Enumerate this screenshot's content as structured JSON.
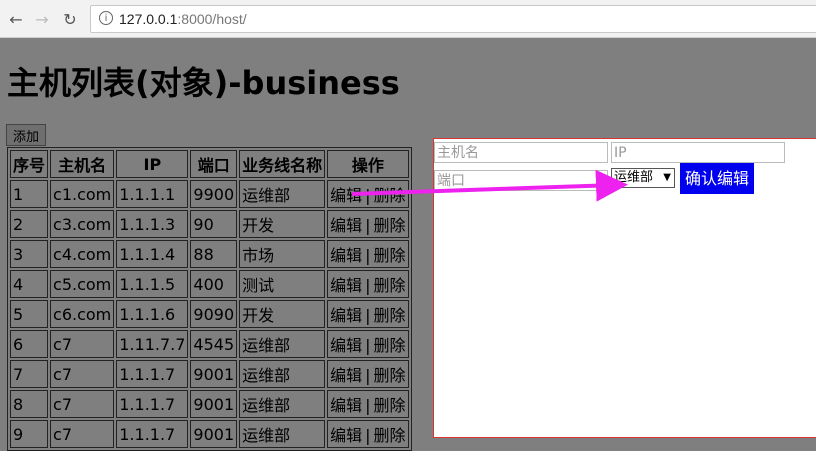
{
  "browser": {
    "url_host": "127.0.0.1",
    "url_path": ":8000/host/",
    "back_icon": "arrow-left-icon",
    "forward_icon": "arrow-right-icon",
    "reload_icon": "reload-icon",
    "info_icon": "info-icon"
  },
  "page": {
    "title": "主机列表(对象)-business",
    "add_label": "添加"
  },
  "table": {
    "headers": [
      "序号",
      "主机名",
      "IP",
      "端口",
      "业务线名称",
      "操作"
    ],
    "rows": [
      [
        "1",
        "c1.com",
        "1.1.1.1",
        "9900",
        "运维部"
      ],
      [
        "2",
        "c3.com",
        "1.1.1.3",
        "90",
        "开发"
      ],
      [
        "3",
        "c4.com",
        "1.1.1.4",
        "88",
        "市场"
      ],
      [
        "4",
        "c5.com",
        "1.1.1.5",
        "400",
        "测试"
      ],
      [
        "5",
        "c6.com",
        "1.1.1.6",
        "9090",
        "开发"
      ],
      [
        "6",
        "c7",
        "1.11.7.7",
        "4545",
        "运维部"
      ],
      [
        "7",
        "c7",
        "1.1.1.7",
        "9001",
        "运维部"
      ],
      [
        "8",
        "c7",
        "1.1.1.7",
        "9001",
        "运维部"
      ],
      [
        "9",
        "c7",
        "1.1.1.7",
        "9001",
        "运维部"
      ]
    ],
    "edit_label": "编辑",
    "separator": "|",
    "delete_label": "删除"
  },
  "modal": {
    "hostname_placeholder": "主机名",
    "ip_placeholder": "IP",
    "port_placeholder": "端口",
    "business_selected": "运维部",
    "confirm_label": "确认编辑"
  },
  "colors": {
    "overlay": "#7f7f7f",
    "confirm_button": "#0000ee",
    "modal_border": "#dd3333",
    "annotation_arrow": "#ee22ee"
  }
}
